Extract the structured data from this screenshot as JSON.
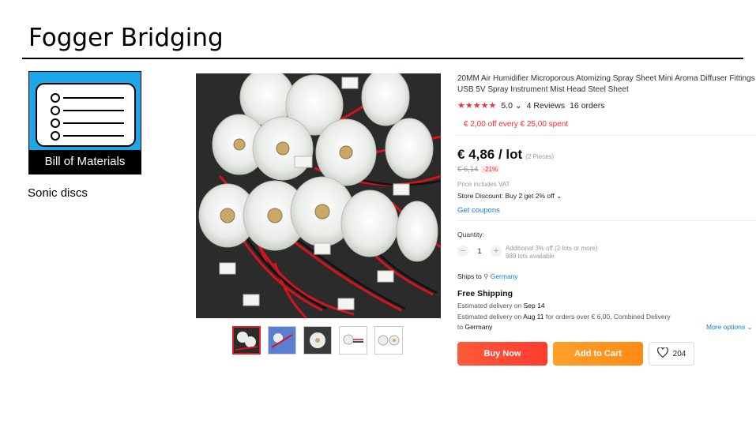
{
  "slide": {
    "title": "Fogger Bridging",
    "subtitle": "Sonic discs"
  },
  "bom": {
    "caption": "Bill of Materials",
    "icon": "checklist-icon"
  },
  "gallery": {
    "thumb_count": 5,
    "active_thumb": 1
  },
  "product": {
    "title": "20MM Air Humidifier Microporous Atomizing Spray Sheet Mini Aroma Diffuser Fittings USB 5V Spray Instrument Mist Head Steel Sheet",
    "rating": "5.0",
    "rating_caret": "⌄",
    "reviews": "4 Reviews",
    "orders": "16 orders",
    "promo": "€ 2,00 off every € 25,00 spent",
    "price": "€ 4,86 / lot",
    "pieces": "(2 Pieces)",
    "old_price": "€ 6,14",
    "discount": "-21%",
    "vat": "Price includes VAT",
    "store_discount": "Store Discount: Buy 2 get 2% off",
    "store_caret": "⌄",
    "coupons": "Get coupons",
    "quantity_label": "Quantity:",
    "quantity": "1",
    "qty_minus": "−",
    "qty_plus": "+",
    "qty_note_1": "Additional 3% off (2 lots or more)",
    "qty_note_2": "989 lots available",
    "ships_to_label": "Ships to",
    "ships_to": "Germany",
    "shipping_title": "Free Shipping",
    "delivery_1_prefix": "Estimated delivery on",
    "delivery_1_date": "Sep 14",
    "delivery_2_prefix": "Estimated delivery on",
    "delivery_2_date": "Aug 11",
    "delivery_2_suffix": "for orders over € 6,00, Combined Delivery",
    "delivery_3_prefix": "to",
    "delivery_3_place": "Germany",
    "more_options": "More options",
    "more_caret": "⌄",
    "buy_now": "Buy Now",
    "add_to_cart": "Add to Cart",
    "wishlist_count": "204"
  },
  "colors": {
    "accent_red": "#ff3b2f",
    "cart_orange": "#ff8b16",
    "link_blue": "#1a7ad8",
    "bom_blue": "#1ea7e8"
  }
}
